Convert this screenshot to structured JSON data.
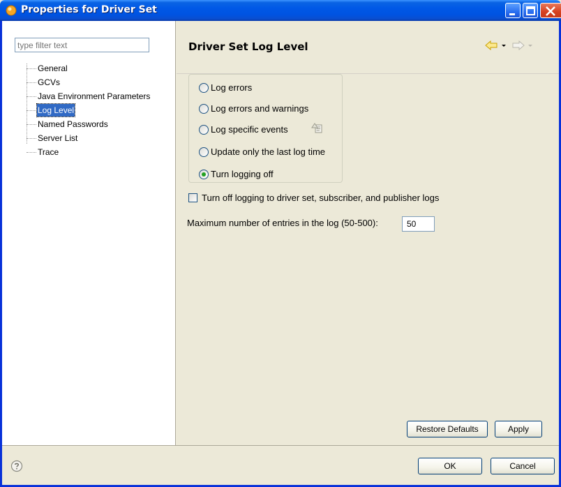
{
  "window": {
    "title": "Properties for Driver Set",
    "accent_color": "#0054e3"
  },
  "sidebar": {
    "filter_placeholder": "type filter text",
    "filter_value": "",
    "items": [
      {
        "label": "General",
        "selected": false
      },
      {
        "label": "GCVs",
        "selected": false
      },
      {
        "label": "Java Environment Parameters",
        "selected": false
      },
      {
        "label": "Log Level",
        "selected": true
      },
      {
        "label": "Named Passwords",
        "selected": false
      },
      {
        "label": "Server List",
        "selected": false
      },
      {
        "label": "Trace",
        "selected": false
      }
    ]
  },
  "main": {
    "page_title": "Driver Set Log Level",
    "nav": {
      "back_icon": "arrow-left-icon",
      "forward_icon": "arrow-right-icon"
    },
    "radios": [
      {
        "label": "Log errors",
        "checked": false
      },
      {
        "label": "Log errors and warnings",
        "checked": false
      },
      {
        "label": "Log specific events",
        "checked": false
      },
      {
        "label": "Update only the last log time",
        "checked": false
      },
      {
        "label": "Turn logging off",
        "checked": true
      }
    ],
    "events_icon": "edit-events-icon",
    "checkbox": {
      "label": "Turn off logging to driver set, subscriber, and publisher logs",
      "checked": false
    },
    "max_entries": {
      "label": "Maximum number of entries in the log (50-500):",
      "value": "50"
    },
    "buttons": {
      "restore_defaults": "Restore Defaults",
      "apply": "Apply"
    }
  },
  "footer": {
    "help_icon": "help-icon",
    "ok": "OK",
    "cancel": "Cancel"
  }
}
